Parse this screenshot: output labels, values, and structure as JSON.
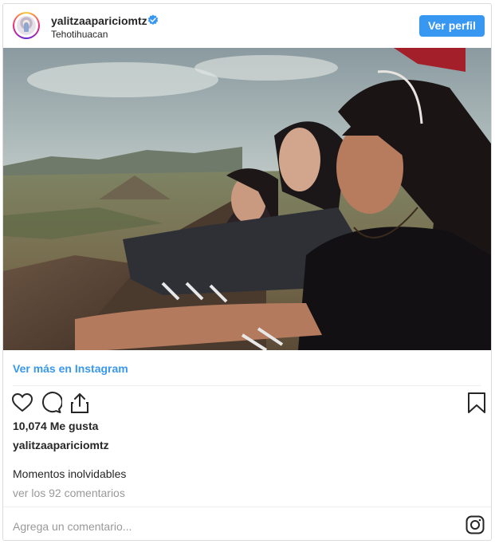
{
  "header": {
    "username": "yalitzaapariciomtz",
    "location": "Tehotihuacan",
    "follow_button": "Ver perfil"
  },
  "post": {
    "more_link": "Ver más en Instagram",
    "likes": "10,074 Me gusta",
    "owner": "yalitzaapariciomtz",
    "caption": "Momentos inolvidables",
    "comments_link": "ver los 92 comentarios",
    "add_comment_placeholder": "Agrega un comentario..."
  },
  "icons": {
    "verified": "verified-badge-icon",
    "like": "heart-icon",
    "comment": "comment-bubble-icon",
    "share": "share-icon",
    "save": "bookmark-icon",
    "brand": "instagram-icon"
  },
  "colors": {
    "accent": "#3897f0",
    "muted_text": "#999999",
    "text": "#262626"
  }
}
